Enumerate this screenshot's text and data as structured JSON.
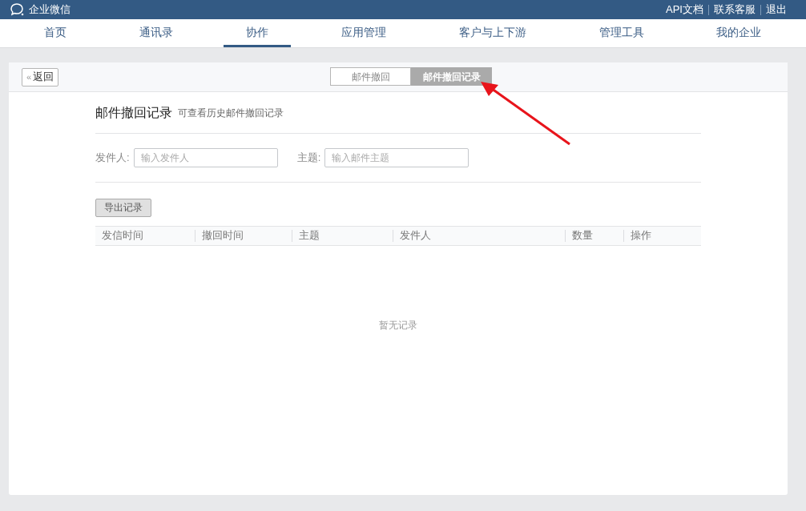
{
  "brand": "企业微信",
  "top_links": [
    "API文档",
    "联系客服",
    "退出"
  ],
  "nav": [
    {
      "label": "首页",
      "selected": false
    },
    {
      "label": "通讯录",
      "selected": false
    },
    {
      "label": "协作",
      "selected": true
    },
    {
      "label": "应用管理",
      "selected": false
    },
    {
      "label": "客户与上下游",
      "selected": false
    },
    {
      "label": "管理工具",
      "selected": false
    },
    {
      "label": "我的企业",
      "selected": false
    }
  ],
  "back_button": {
    "icon": "«",
    "label": "返回"
  },
  "tabs": [
    {
      "label": "邮件撤回",
      "selected": false
    },
    {
      "label": "邮件撤回记录",
      "selected": true
    }
  ],
  "title": "邮件撤回记录",
  "subtitle": "可查看历史邮件撤回记录",
  "filters": [
    {
      "label": "发件人:",
      "placeholder": "输入发件人"
    },
    {
      "label": "主题:",
      "placeholder": "输入邮件主题"
    }
  ],
  "export_button": "导出记录",
  "table": {
    "columns": [
      "发信时间",
      "撤回时间",
      "主题",
      "发件人",
      "数量",
      "操作"
    ],
    "empty_text": "暂无记录"
  }
}
